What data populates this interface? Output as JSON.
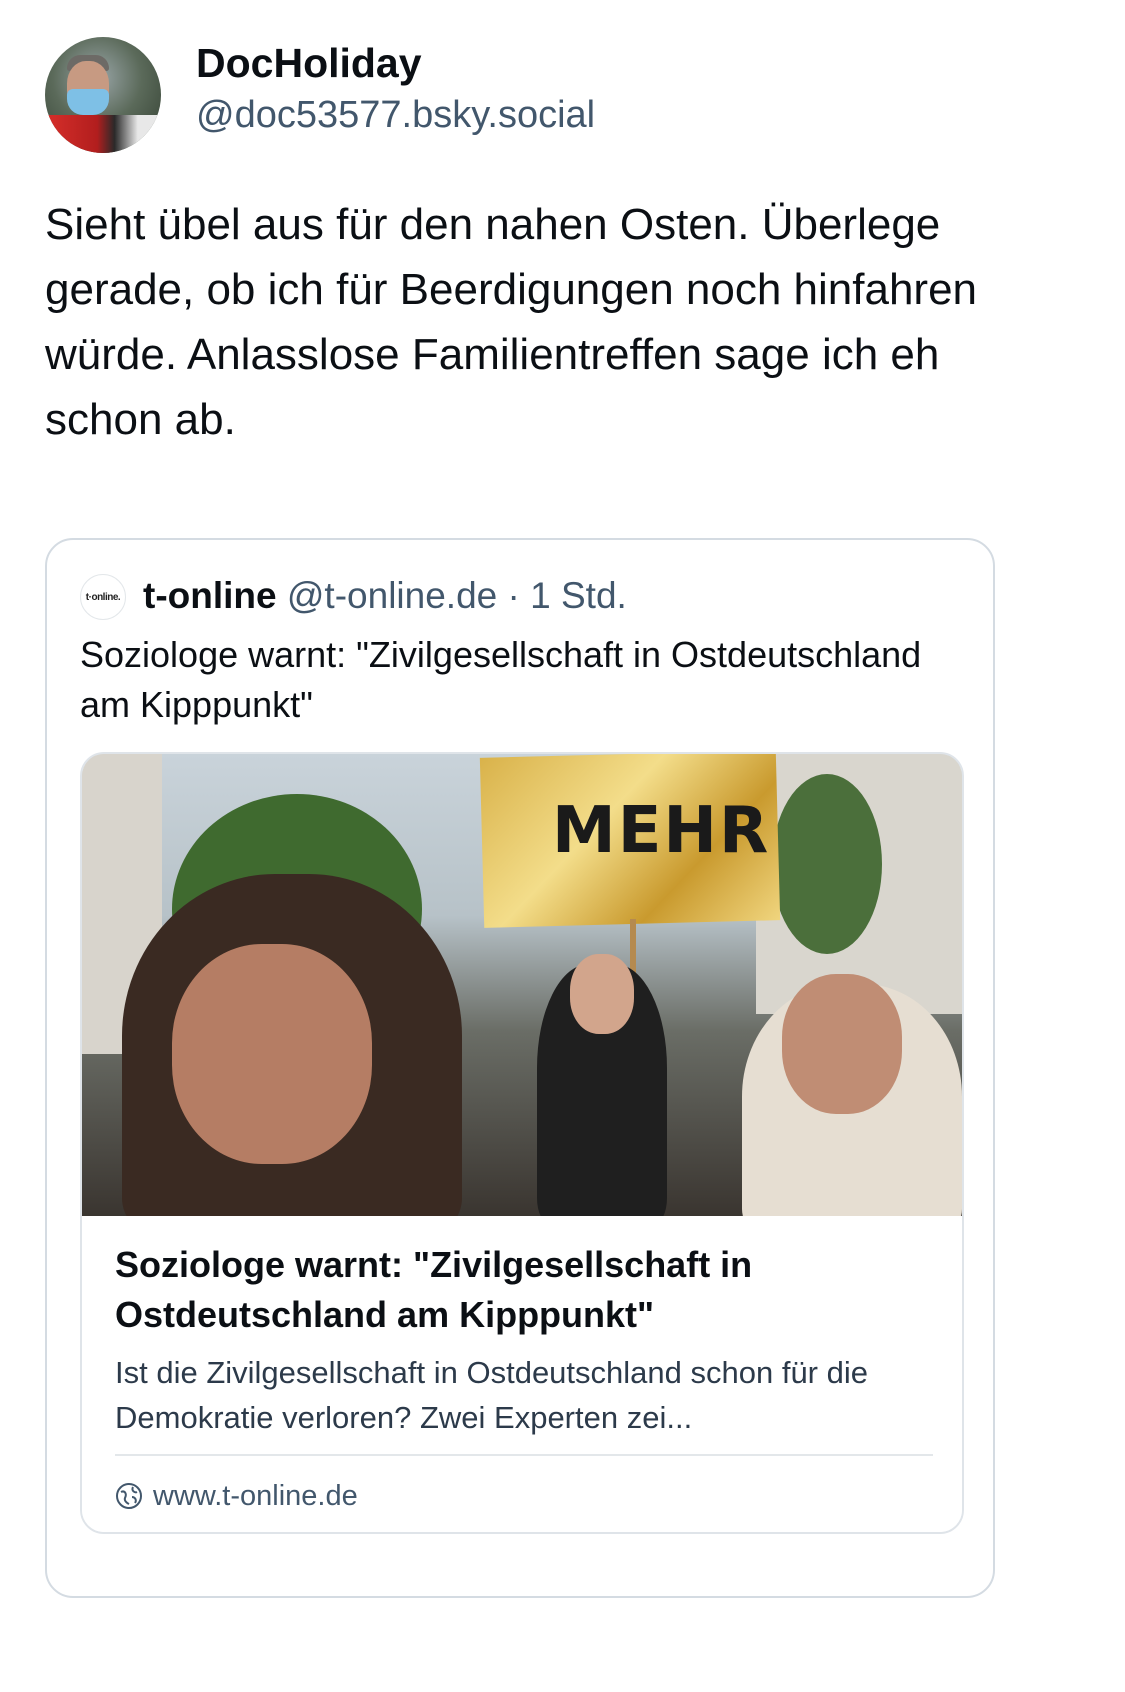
{
  "post": {
    "author": {
      "display_name": "DocHoliday",
      "handle": "@doc53577.bsky.social",
      "avatar_icon": "user-avatar-photo"
    },
    "text": "Sieht übel aus für den nahen Osten. Überlege gerade, ob ich für Beerdigungen noch hinfahren würde. Anlasslose Familientreffen sage ich eh schon ab."
  },
  "quote": {
    "avatar_text": "t·online.",
    "name": "t-online",
    "handle": "@t-online.de",
    "separator": "·",
    "time": "1 Std.",
    "text": "Soziologe warnt: \"Zivilgesellschaft in Ostdeutschland am Kipppunkt\"",
    "link_card": {
      "image_sign_text": "MEHR",
      "title": "Soziologe warnt: \"Zivilgesellschaft in Ostdeutschland am Kipppunkt\"",
      "description": "Ist die Zivilgesellschaft in Ostdeutschland schon für die Demokratie verloren? Zwei Experten zei...",
      "domain": "www.t-online.de",
      "domain_icon": "globe-icon"
    }
  },
  "colors": {
    "text_primary": "#0b0f14",
    "text_secondary": "#42576c",
    "border": "#d4dbe2"
  }
}
